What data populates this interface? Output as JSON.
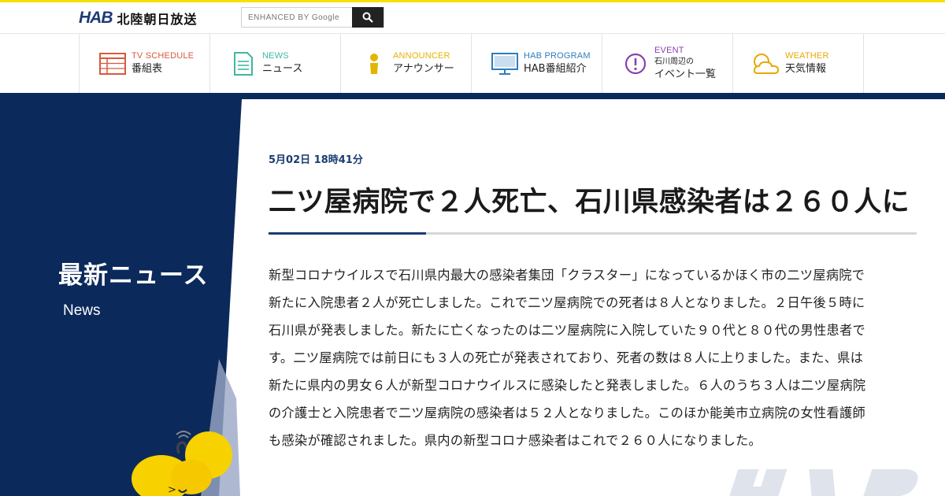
{
  "header": {
    "logo_mark": "HAB",
    "logo_text": "北陸朝日放送",
    "search_placeholder": "ENHANCED BY Google"
  },
  "nav": [
    {
      "en": "TV SCHEDULE",
      "jp": "番組表",
      "icon": "tv-schedule-grid-icon",
      "color": "#d9593f"
    },
    {
      "en": "NEWS",
      "jp": "ニュース",
      "icon": "news-document-icon",
      "color": "#3fb7a3"
    },
    {
      "en": "ANNOUNCER",
      "jp": "アナウンサー",
      "icon": "announcer-person-icon",
      "color": "#e3b500"
    },
    {
      "en": "HAB PROGRAM",
      "jp": "HAB番組紹介",
      "icon": "monitor-icon",
      "color": "#2e7dbf"
    },
    {
      "en": "EVENT",
      "jp_line1": "石川周辺の",
      "jp_line2": "イベント一覧",
      "icon": "exclamation-circle-icon",
      "color": "#8a3fb0"
    },
    {
      "en": "WEATHER",
      "jp": "天気情報",
      "icon": "weather-cloud-sun-icon",
      "color": "#e8a800"
    }
  ],
  "side": {
    "title": "最新ニュース",
    "subtitle": "News"
  },
  "article": {
    "date": "5月02日 18時41分",
    "headline": "二ツ屋病院で２人死亡、石川県感染者は２６０人に",
    "body": "新型コロナウイルスで石川県内最大の感染者集団「クラスター」になっているかほく市の二ツ屋病院で新たに入院患者２人が死亡しました。これで二ツ屋病院での死者は８人となりました。２日午後５時に石川県が発表しました。新たに亡くなったのは二ツ屋病院に入院していた９０代と８０代の男性患者です。二ツ屋病院では前日にも３人の死亡が発表されており、死者の数は８人に上りました。また、県は新たに県内の男女６人が新型コロナウイルスに感染したと発表しました。６人のうち３人は二ツ屋病院の介護士と入院患者で二ツ屋病院の感染者は５２人となりました。このほか能美市立病院の女性看護師も感染が確認されました。県内の新型コロナ感染者はこれで２６０人になりました。"
  },
  "colors": {
    "brand_navy": "#0b2a5b",
    "accent_yellow": "#f5e200",
    "date_blue": "#1a3c73"
  }
}
